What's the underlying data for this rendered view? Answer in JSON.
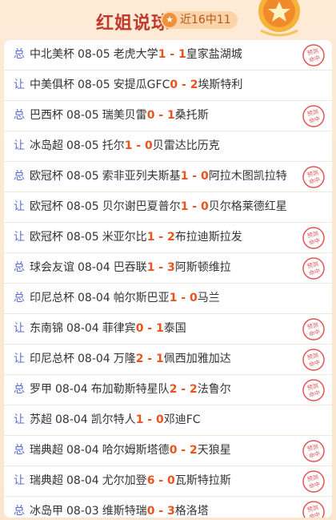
{
  "header": {
    "title": "红姐说球",
    "badge": "近16中11",
    "star_icon": "star-icon",
    "medal_icon": "star-medal-icon"
  },
  "colors": {
    "accent": "#c0392b",
    "score": "#e8541c",
    "pick": "#5a6bd6",
    "stamp": "#e05555"
  },
  "stamp": {
    "line1": "预测",
    "line2": "命中"
  },
  "matches": [
    {
      "pick": "总",
      "league": "中北美杯",
      "date": "08-05",
      "home": "老虎大学",
      "home_score": "1",
      "away_score": "1",
      "away": "皇家盐湖城",
      "hit": true
    },
    {
      "pick": "让",
      "league": "中美俱杯",
      "date": "08-05",
      "home": "安提瓜GFC",
      "home_score": "0",
      "away_score": "2",
      "away": "埃斯特利",
      "hit": false
    },
    {
      "pick": "总",
      "league": "巴西杯",
      "date": "08-05",
      "home": "瑞美贝雷",
      "home_score": "0",
      "away_score": "1",
      "away": "桑托斯",
      "hit": true
    },
    {
      "pick": "让",
      "league": "冰岛超",
      "date": "08-05",
      "home": "托尔",
      "home_score": "1",
      "away_score": "0",
      "away": "贝雷达比历克",
      "hit": false
    },
    {
      "pick": "总",
      "league": "欧冠杯",
      "date": "08-05",
      "home": "索非亚列夫斯基",
      "home_score": "1",
      "away_score": "0",
      "away": "阿拉木图凯拉特",
      "hit": true
    },
    {
      "pick": "让",
      "league": "欧冠杯",
      "date": "08-05",
      "home": "贝尔谢巴夏普尔",
      "home_score": "1",
      "away_score": "0",
      "away": "贝尔格莱德红星",
      "hit": false
    },
    {
      "pick": "让",
      "league": "欧冠杯",
      "date": "08-05",
      "home": "米亚尔比",
      "home_score": "1",
      "away_score": "2",
      "away": "布拉迪斯拉发",
      "hit": true
    },
    {
      "pick": "总",
      "league": "球会友谊",
      "date": "08-04",
      "home": "巴吞联",
      "home_score": "1",
      "away_score": "3",
      "away": "阿斯顿维拉",
      "hit": true
    },
    {
      "pick": "总",
      "league": "印尼总杯",
      "date": "08-04",
      "home": "帕尔斯巴亚",
      "home_score": "1",
      "away_score": "0",
      "away": "马兰",
      "hit": false
    },
    {
      "pick": "让",
      "league": "东南锦",
      "date": "08-04",
      "home": "菲律宾",
      "home_score": "0",
      "away_score": "1",
      "away": "泰国",
      "hit": true
    },
    {
      "pick": "让",
      "league": "印尼总杯",
      "date": "08-04",
      "home": "万隆",
      "home_score": "2",
      "away_score": "1",
      "away": "佩西加雅加达",
      "hit": true
    },
    {
      "pick": "总",
      "league": "罗甲",
      "date": "08-04",
      "home": "布加勒斯特星队",
      "home_score": "2",
      "away_score": "2",
      "away": "法鲁尔",
      "hit": true
    },
    {
      "pick": "让",
      "league": "苏超",
      "date": "08-04",
      "home": "凯尔特人",
      "home_score": "1",
      "away_score": "0",
      "away": "邓迪FC",
      "hit": false
    },
    {
      "pick": "总",
      "league": "瑞典超",
      "date": "08-04",
      "home": "哈尔姆斯塔德",
      "home_score": "0",
      "away_score": "2",
      "away": "天狼星",
      "hit": true
    },
    {
      "pick": "让",
      "league": "瑞典超",
      "date": "08-04",
      "home": "尤尔加登",
      "home_score": "6",
      "away_score": "0",
      "away": "瓦斯特拉斯",
      "hit": true
    },
    {
      "pick": "总",
      "league": "冰岛甲",
      "date": "08-03",
      "home": "维斯特瑞",
      "home_score": "0",
      "away_score": "3",
      "away": "格洛塔",
      "hit": true
    }
  ]
}
